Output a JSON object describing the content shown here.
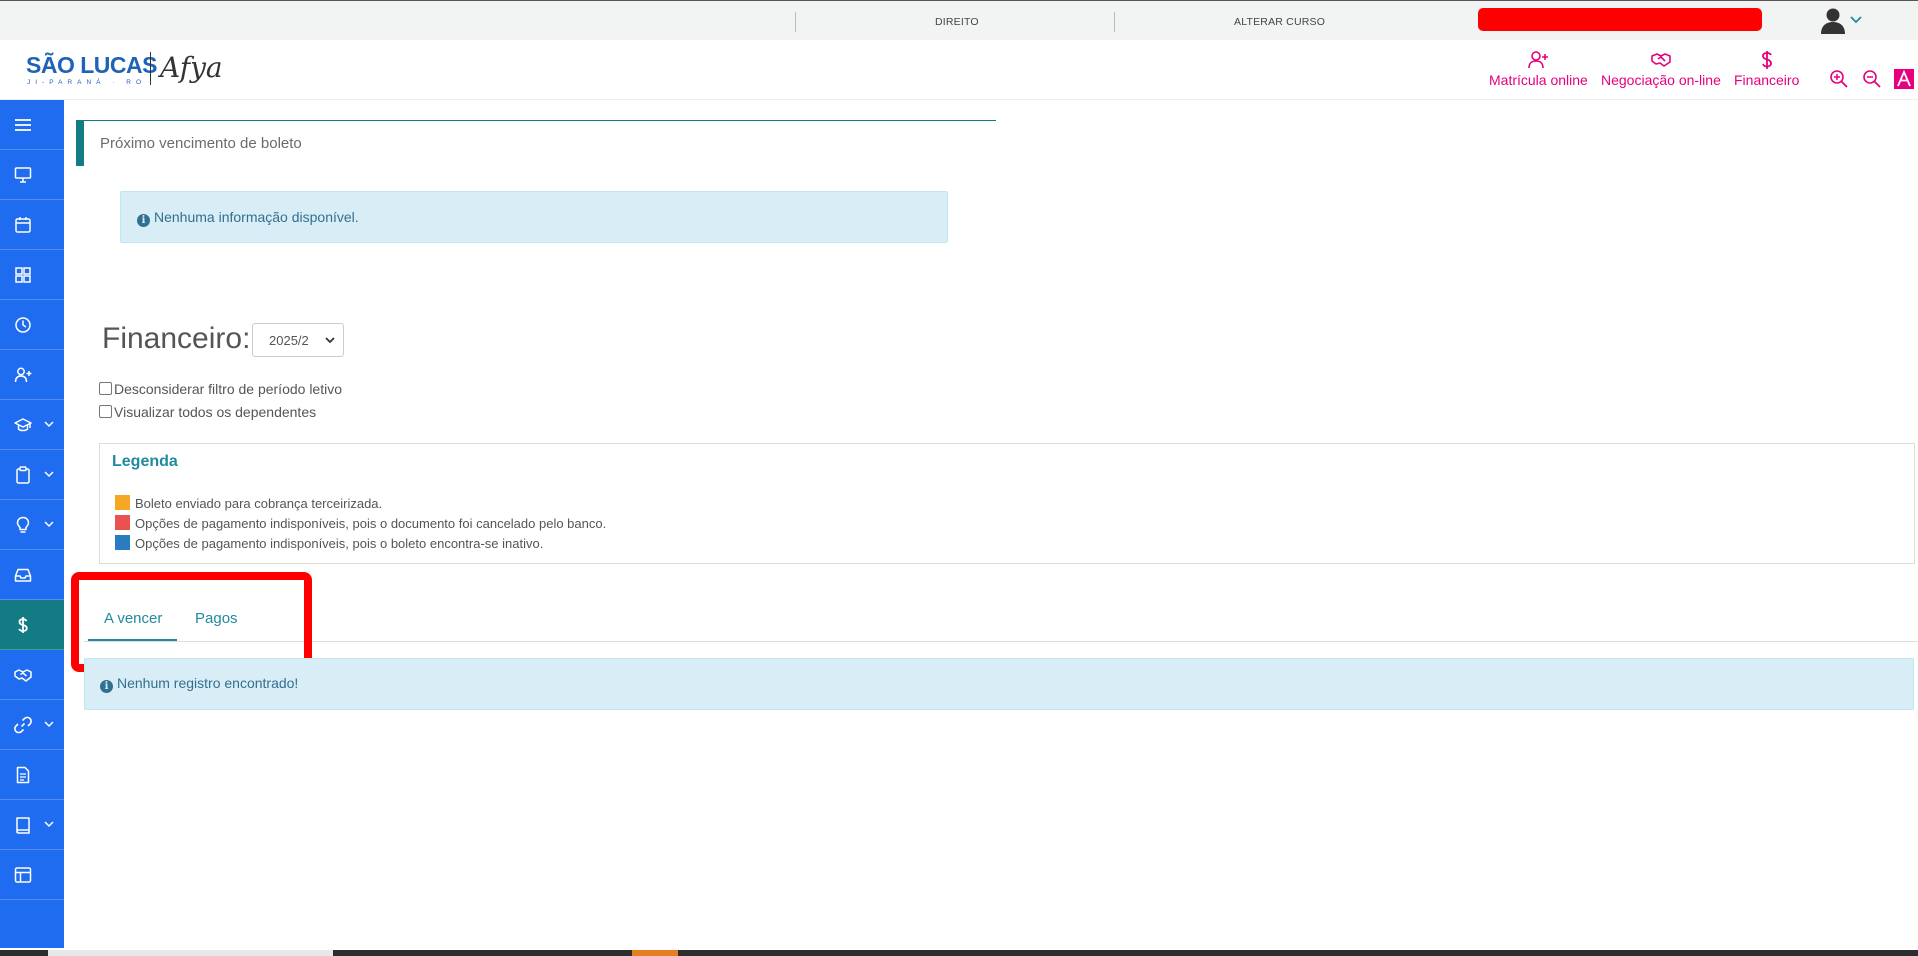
{
  "topbar": {
    "course": "DIREITO",
    "change_course": "ALTERAR CURSO"
  },
  "header": {
    "logo_main": "SÃO LUCAS",
    "logo_sub": "JI-PARANÁ · RO",
    "logo_partner": "Afya",
    "quick_links": [
      {
        "label": "Matrícula online",
        "icon": "user-plus-icon"
      },
      {
        "label": "Negociação on-line",
        "icon": "handshake-icon"
      },
      {
        "label": "Financeiro",
        "icon": "dollar-icon"
      }
    ],
    "tools": [
      "zoom-in-icon",
      "zoom-out-icon",
      "contrast-icon"
    ]
  },
  "sidebar": {
    "items": [
      {
        "icon": "menu-icon",
        "chevron": false
      },
      {
        "icon": "monitor-icon",
        "chevron": false
      },
      {
        "icon": "calendar-icon",
        "chevron": false
      },
      {
        "icon": "grid-icon",
        "chevron": false
      },
      {
        "icon": "clock-icon",
        "chevron": false
      },
      {
        "icon": "user-plus-icon",
        "chevron": false
      },
      {
        "icon": "graduation-cap-icon",
        "chevron": true
      },
      {
        "icon": "clipboard-icon",
        "chevron": true
      },
      {
        "icon": "lightbulb-icon",
        "chevron": true
      },
      {
        "icon": "inbox-icon",
        "chevron": false
      },
      {
        "icon": "dollar-icon",
        "chevron": false,
        "active": true
      },
      {
        "icon": "handshake-icon",
        "chevron": false
      },
      {
        "icon": "link-icon",
        "chevron": true
      },
      {
        "icon": "document-icon",
        "chevron": false
      },
      {
        "icon": "book-icon",
        "chevron": true
      },
      {
        "icon": "layout-icon",
        "chevron": false
      }
    ]
  },
  "next_due": {
    "title": "Próximo vencimento de boleto",
    "empty_message": "Nenhuma informação disponível."
  },
  "financeiro": {
    "title": "Financeiro:",
    "period_selected": "2025/2",
    "checkbox_ignore_period": "Desconsiderar filtro de período letivo",
    "checkbox_all_dependents": "Visualizar todos os dependentes"
  },
  "legend": {
    "title": "Legenda",
    "items": [
      {
        "color": "#f5a623",
        "text": "Boleto enviado para cobrança terceirizada."
      },
      {
        "color": "#e8524f",
        "text": "Opções de pagamento indisponíveis, pois o documento foi cancelado pelo banco."
      },
      {
        "color": "#2a7bbf",
        "text": "Opções de pagamento indisponíveis, pois o boleto encontra-se inativo."
      }
    ]
  },
  "tabs": {
    "items": [
      {
        "label": "A vencer",
        "active": true
      },
      {
        "label": "Pagos",
        "active": false
      }
    ]
  },
  "records": {
    "empty_message": "Nenhum registro encontrado!"
  },
  "colors": {
    "sidebar": "#1f6cf0",
    "sidebar_active": "#137b84",
    "accent_pink": "#e6007e",
    "teal": "#1f8aa0",
    "highlight": "#ff0000"
  }
}
